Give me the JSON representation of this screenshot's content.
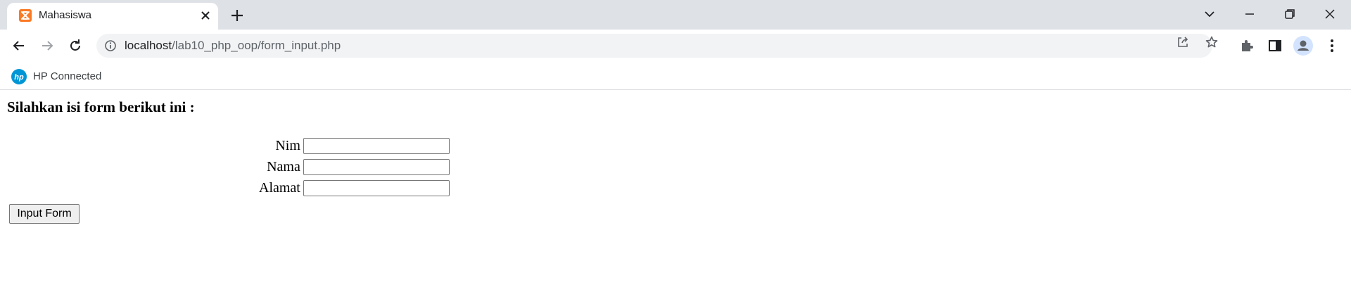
{
  "browser": {
    "tab": {
      "title": "Mahasiswa",
      "favicon": "xampp-icon"
    },
    "address": {
      "host": "localhost",
      "path": "/lab10_php_oop/form_input.php"
    },
    "bookmarks": [
      {
        "label": "HP Connected",
        "icon": "hp-logo-icon"
      }
    ]
  },
  "page": {
    "heading": "Silahkan isi form berikut ini :",
    "fields": [
      {
        "label": "Nim",
        "value": ""
      },
      {
        "label": "Nama",
        "value": ""
      },
      {
        "label": "Alamat",
        "value": ""
      }
    ],
    "submit_label": "Input Form"
  },
  "colors": {
    "tabstrip": "#dee1e6",
    "omnibox": "#f1f3f4",
    "favicon": "#fb7a24",
    "hp_blue": "#0096d6"
  }
}
